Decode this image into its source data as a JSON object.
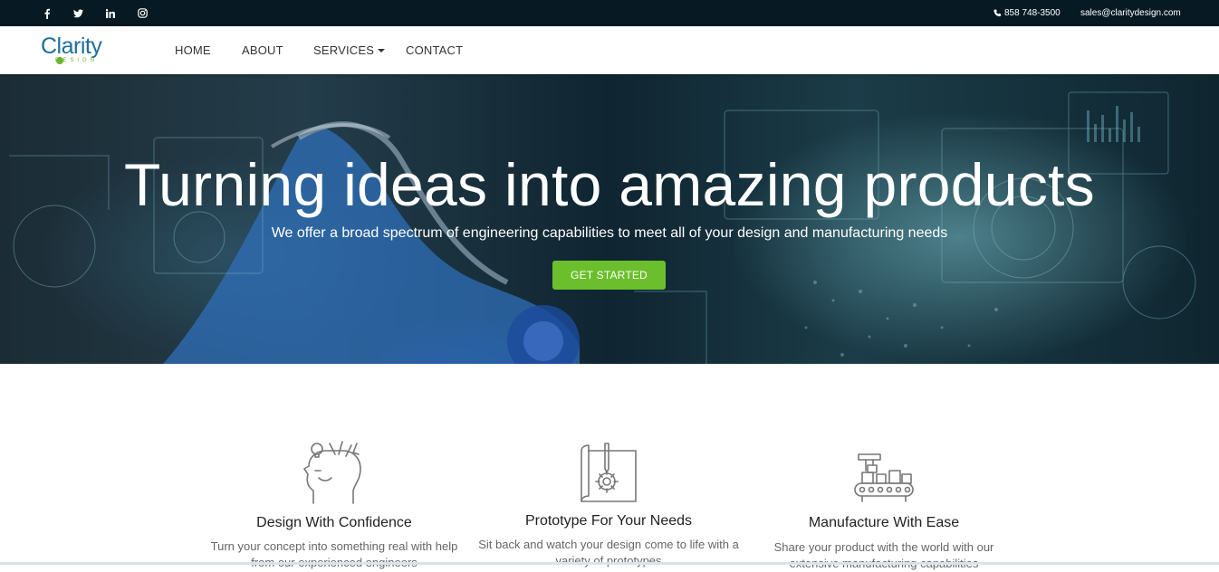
{
  "topbar": {
    "social": [
      {
        "name": "facebook-icon",
        "glyph": "f"
      },
      {
        "name": "twitter-icon",
        "glyph": "t"
      },
      {
        "name": "linkedin-icon",
        "glyph": "in"
      },
      {
        "name": "instagram-icon",
        "glyph": "ig"
      }
    ],
    "phone": "858 748-3500",
    "email": "sales@claritydesign.com"
  },
  "logo": {
    "word": "Clarity",
    "sub": "DESIGN"
  },
  "nav": {
    "home": "HOME",
    "about": "ABOUT",
    "services": "SERVICES",
    "contact": "CONTACT"
  },
  "hero": {
    "title": "Turning ideas into amazing products",
    "subtitle": "We offer a broad spectrum of engineering capabilities to meet all of your design and manufacturing needs",
    "cta": "GET STARTED"
  },
  "features": [
    {
      "icon": "head-ideas-icon",
      "title": "Design With Confidence",
      "text": "Turn your concept into something real with help from our experienced engineers"
    },
    {
      "icon": "blueprint-gear-icon",
      "title": "Prototype For Your Needs",
      "text": "Sit back and watch your design come to life with a variety of prototypes"
    },
    {
      "icon": "factory-conveyor-icon",
      "title": "Manufacture With Ease",
      "text": "Share your product with the world with our extensive manufacturing capabilities"
    }
  ],
  "colors": {
    "topbar": "#071a24",
    "brand_blue": "#1d6f99",
    "brand_green": "#6cbf2c"
  }
}
